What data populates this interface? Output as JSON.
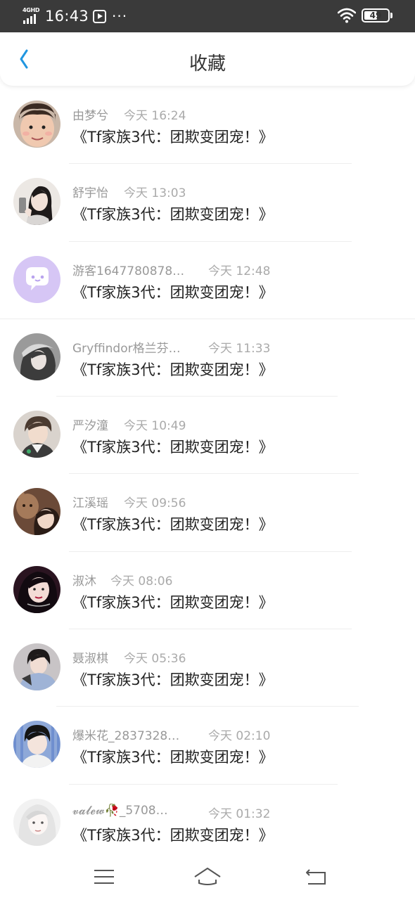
{
  "status_bar": {
    "network": "4GHD",
    "time": "16:43",
    "more": "···",
    "battery": "49",
    "icons": [
      "signal-icon",
      "video-play-icon",
      "wifi-icon",
      "battery-icon"
    ]
  },
  "header": {
    "title": "收藏",
    "back_icon": "chevron-left-icon",
    "accent_color": "#2196e0"
  },
  "favorites": [
    {
      "name": "由梦兮",
      "time": "今天 16:24",
      "title": "《Tf家族3代：团欺变团宠！》",
      "avatar": "photo"
    },
    {
      "name": "舒宇怡",
      "time": "今天 13:03",
      "title": "《Tf家族3代：团欺变团宠！》",
      "avatar": "photo"
    },
    {
      "name": "游客1647780878…",
      "time": "今天 12:48",
      "title": "《Tf家族3代：团欺变团宠！》",
      "avatar": "default-chat-bubble"
    },
    {
      "name": "Gryffindor格兰芬…",
      "time": "今天 11:33",
      "title": "《Tf家族3代：团欺变团宠！》",
      "avatar": "photo"
    },
    {
      "name": "严汐潼",
      "time": "今天 10:49",
      "title": "《Tf家族3代：团欺变团宠！》",
      "avatar": "photo"
    },
    {
      "name": "江溪瑶",
      "time": "今天 09:56",
      "title": "《Tf家族3代：团欺变团宠！》",
      "avatar": "photo"
    },
    {
      "name": "淑沐",
      "time": "今天 08:06",
      "title": "《Tf家族3代：团欺变团宠！》",
      "avatar": "photo"
    },
    {
      "name": "聂淑棋",
      "time": "今天 05:36",
      "title": "《Tf家族3代：团欺变团宠！》",
      "avatar": "photo"
    },
    {
      "name": "爆米花_2837328…",
      "time": "今天 02:10",
      "title": "《Tf家族3代：团欺变团宠！》",
      "avatar": "photo"
    },
    {
      "name": "𝓿𝓪𝓵𝓮𝔀🥀_5708…",
      "time": "今天 01:32",
      "title": "《Tf家族3代：团欺变团宠！》",
      "avatar": "photo"
    }
  ],
  "bottom_nav": {
    "icons": [
      "menu-icon",
      "home-icon",
      "back-icon"
    ]
  }
}
